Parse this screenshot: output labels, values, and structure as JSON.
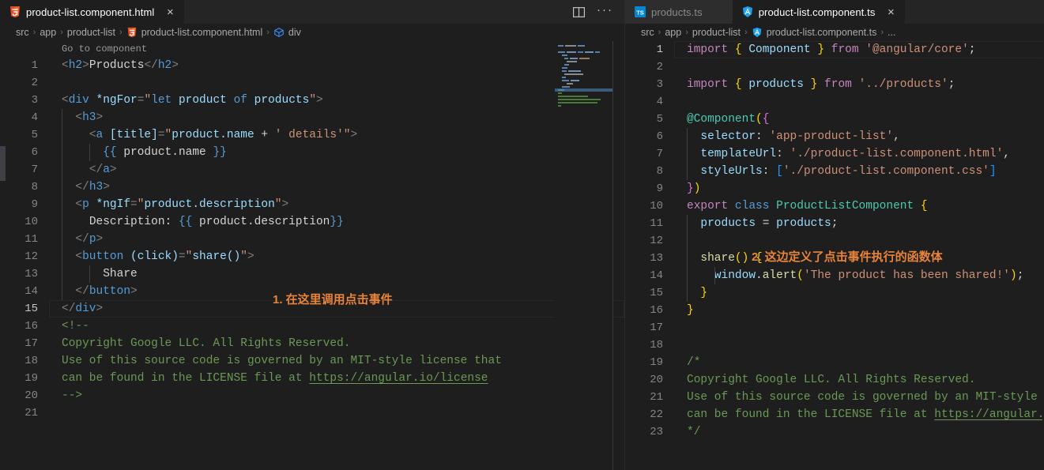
{
  "left_group": {
    "tabs": [
      {
        "label": "product-list.component.html",
        "icon": "html5-icon",
        "active": true,
        "close": "×"
      }
    ],
    "actions": [
      {
        "name": "split-editor-right-icon"
      },
      {
        "name": "more-actions-icon",
        "glyph": "···"
      }
    ],
    "breadcrumb": [
      {
        "text": "src",
        "icon": null
      },
      {
        "text": "app",
        "icon": null
      },
      {
        "text": "product-list",
        "icon": null
      },
      {
        "text": "product-list.component.html",
        "icon": "html5-icon"
      },
      {
        "text": "div",
        "icon": "symbol-field-icon"
      }
    ],
    "breadcrumb_separator": "›",
    "codelens": "Go to component",
    "lines": [
      {
        "n": "1",
        "current": false
      },
      {
        "n": "2",
        "current": false
      },
      {
        "n": "3",
        "current": false
      },
      {
        "n": "4",
        "current": false
      },
      {
        "n": "5",
        "current": false
      },
      {
        "n": "6",
        "current": false
      },
      {
        "n": "7",
        "current": false
      },
      {
        "n": "8",
        "current": false
      },
      {
        "n": "9",
        "current": false
      },
      {
        "n": "10",
        "current": false
      },
      {
        "n": "11",
        "current": false
      },
      {
        "n": "12",
        "current": false
      },
      {
        "n": "13",
        "current": false
      },
      {
        "n": "14",
        "current": false
      },
      {
        "n": "15",
        "current": true
      },
      {
        "n": "16",
        "current": false
      },
      {
        "n": "17",
        "current": false
      },
      {
        "n": "18",
        "current": false
      },
      {
        "n": "19",
        "current": false
      },
      {
        "n": "20",
        "current": false
      },
      {
        "n": "21",
        "current": false
      }
    ],
    "code_text": {
      "l1": "<h2>Products</h2>",
      "l2": "",
      "l3": "<div *ngFor=\"let product of products\">",
      "l4": "  <h3>",
      "l5": "    <a [title]=\"product.name + ' details'\">",
      "l6": "      {{ product.name }}",
      "l7": "    </a>",
      "l8": "  </h3>",
      "l9": "  <p *ngIf=\"product.description\">",
      "l10": "    Description: {{ product.description}}",
      "l11": "  </p>",
      "l12": "  <button (click)=\"share()\">",
      "l13": "      Share",
      "l14": "  </button>",
      "l15": "</div>",
      "l16": "<!--",
      "l17": "Copyright Google LLC. All Rights Reserved.",
      "l18": "Use of this source code is governed by an MIT-style license that",
      "l19": "can be found in the LICENSE file at https://angular.io/license",
      "l20": "-->",
      "l21": ""
    },
    "tokens": {
      "h2_open_lt": "<",
      "h2_open_name": "h2",
      "h2_open_gt": ">",
      "h2_text": "Products",
      "h2_close_lt": "</",
      "h2_close_name": "h2",
      "h2_close_gt": ">",
      "div_lt": "<",
      "div_name": "div",
      "ngfor_attr": "*ngFor",
      "eq": "=",
      "ngfor_q1": "\"",
      "ngfor_let": "let",
      "ngfor_product": " product ",
      "ngfor_of": "of",
      "ngfor_products": " products",
      "ngfor_q2": "\"",
      "gt": ">",
      "h3_lt": "<",
      "h3_name": "h3",
      "h3_gt": ">",
      "a_lt": "<",
      "a_name": "a",
      "title_attr": "[title]",
      "title_q1": "\"",
      "title_expr1": "product.name ",
      "title_plus": "+",
      "title_expr2": " ' details'",
      "title_q2": "\"",
      "interp_open": "{{",
      "interp_name": " product.name ",
      "interp_close": "}}",
      "a_close_lt": "</",
      "a_close_name": "a",
      "a_close_gt": ">",
      "h3_close_lt": "</",
      "h3_close_name": "h3",
      "h3_close_gt": ">",
      "p_lt": "<",
      "p_name": "p",
      "ngif_attr": "*ngIf",
      "ngif_q1": "\"",
      "ngif_val": "product.description",
      "ngif_q2": "\"",
      "desc_label": "Description: ",
      "desc_interp_open": "{{",
      "desc_interp_name": " product.description",
      "desc_interp_close": "}}",
      "p_close_lt": "</",
      "p_close_name": "p",
      "p_close_gt": ">",
      "btn_lt": "<",
      "btn_name": "button",
      "click_attr": "(click)",
      "click_q1": "\"",
      "click_val": "share()",
      "click_q2": "\"",
      "btn_text": "Share",
      "btn_close_lt": "</",
      "btn_close_name": "button",
      "btn_close_gt": ">",
      "div_close_lt": "</",
      "div_close_name": "div",
      "div_close_gt": ">",
      "comment_open": "<!--",
      "comment_l1": "Copyright Google LLC. All Rights Reserved.",
      "comment_l2": "Use of this source code is governed by an MIT-style license that",
      "comment_l3a": "can be found in the LICENSE file at ",
      "comment_link": "https://angular.io/license",
      "comment_close": "-->"
    },
    "annotation": "1. 在这里调用点击事件"
  },
  "right_group": {
    "tabs": [
      {
        "label": "products.ts",
        "icon": "typescript-icon",
        "active": false,
        "close": "×"
      },
      {
        "label": "product-list.component.ts",
        "icon": "angular-icon",
        "active": true,
        "close": "×"
      }
    ],
    "breadcrumb": [
      {
        "text": "src",
        "icon": null
      },
      {
        "text": "app",
        "icon": null
      },
      {
        "text": "product-list",
        "icon": null
      },
      {
        "text": "product-list.component.ts",
        "icon": "angular-icon"
      },
      {
        "text": "...",
        "icon": null
      }
    ],
    "breadcrumb_separator": "›",
    "lines": [
      {
        "n": "1",
        "current": true
      },
      {
        "n": "2",
        "current": false
      },
      {
        "n": "3",
        "current": false
      },
      {
        "n": "4",
        "current": false
      },
      {
        "n": "5",
        "current": false
      },
      {
        "n": "6",
        "current": false
      },
      {
        "n": "7",
        "current": false
      },
      {
        "n": "8",
        "current": false
      },
      {
        "n": "9",
        "current": false
      },
      {
        "n": "10",
        "current": false
      },
      {
        "n": "11",
        "current": false
      },
      {
        "n": "12",
        "current": false
      },
      {
        "n": "13",
        "current": false
      },
      {
        "n": "14",
        "current": false
      },
      {
        "n": "15",
        "current": false
      },
      {
        "n": "16",
        "current": false
      },
      {
        "n": "17",
        "current": false
      },
      {
        "n": "18",
        "current": false
      },
      {
        "n": "19",
        "current": false
      },
      {
        "n": "20",
        "current": false
      },
      {
        "n": "21",
        "current": false
      },
      {
        "n": "22",
        "current": false
      },
      {
        "n": "23",
        "current": false
      }
    ],
    "code_text": {
      "l1": "import { Component } from '@angular/core';",
      "l2": "",
      "l3": "import { products } from '../products';",
      "l4": "",
      "l5": "@Component({",
      "l6": "  selector: 'app-product-list',",
      "l7": "  templateUrl: './product-list.component.html',",
      "l8": "  styleUrls: ['./product-list.component.css']",
      "l9": "})",
      "l10": "export class ProductListComponent {",
      "l11": "  products = products;",
      "l12": "",
      "l13": "  share() {",
      "l14": "    window.alert('The product has been shared!');",
      "l15": "  }",
      "l16": "}",
      "l17": "",
      "l18": "",
      "l19": "/*",
      "l20": "Copyright Google LLC. All Rights Reserved.",
      "l21": "Use of this source code is governed by an MIT-style",
      "l22": "can be found in the LICENSE file at https://angular.",
      "l23": "*/"
    },
    "tokens": {
      "import_kw": "import",
      "brace_open": "{",
      "brace_close": "}",
      "component_id": " Component ",
      "from_kw": "from",
      "angular_core_str": "'@angular/core'",
      "semi": ";",
      "products_id": " products ",
      "products_path_str": "'../products'",
      "at": "@",
      "component_deco": "Component",
      "paren_open": "(",
      "paren_close": ")",
      "selector_key": "selector",
      "colon": ":",
      "selector_val": "'app-product-list'",
      "comma": ",",
      "templateurl_key": "templateUrl",
      "templateurl_val": "'./product-list.component.html'",
      "styleurls_key": "styleUrls",
      "bracket_open": "[",
      "bracket_close": "]",
      "styleurls_val": "'./product-list.component.css'",
      "export_kw": "export",
      "class_kw": "class",
      "class_name": "ProductListComponent",
      "prop_products": "products",
      "eq": "=",
      "val_products": "products",
      "share_fn": "share",
      "window_obj": "window",
      "dot": ".",
      "alert_fn": "alert",
      "alert_str": "'The product has been shared!'",
      "comment_open": "/*",
      "comment_l1": "Copyright Google LLC. All Rights Reserved.",
      "comment_l2": "Use of this source code is governed by an MIT-style",
      "comment_l3a": "can be found in the LICENSE file at ",
      "comment_link": "https://angular.",
      "comment_close": "*/"
    },
    "annotation": "2. 这边定义了点击事件执行的函数体"
  },
  "theme": {
    "editor_bg": "#1e1e1e",
    "tabbar_bg": "#252526",
    "tab_inactive_bg": "#2d2d2d",
    "line_number": "#858585",
    "tag_blue": "#569cd6",
    "attr_light_blue": "#9cdcfe",
    "string_orange": "#ce9178",
    "comment_green": "#6a9955",
    "keyword_purple": "#c586c0",
    "type_teal": "#4ec9b0",
    "function_yellow": "#dcdcaa",
    "annotation_orange": "#e8833a",
    "html_icon": "#e44d26",
    "ts_icon": "#0288d1",
    "angular_icon": "#1e9fee"
  }
}
